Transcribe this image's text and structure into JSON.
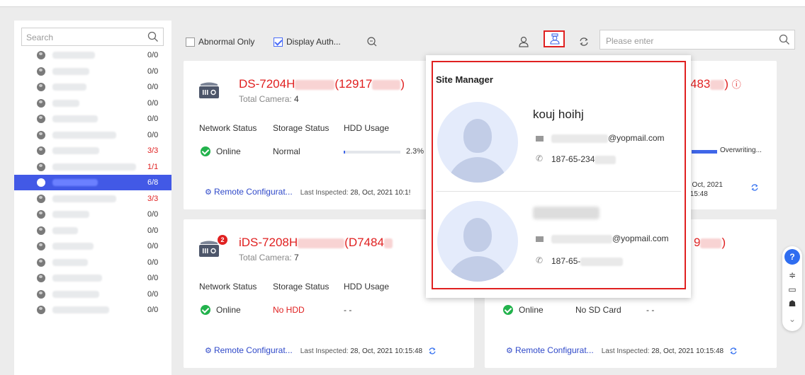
{
  "sidebar": {
    "search_placeholder": "Search",
    "rows": [
      {
        "count": "0/0",
        "warn": false,
        "selected": false
      },
      {
        "count": "0/0",
        "warn": false,
        "selected": false
      },
      {
        "count": "0/0",
        "warn": false,
        "selected": false
      },
      {
        "count": "0/0",
        "warn": false,
        "selected": false
      },
      {
        "count": "0/0",
        "warn": false,
        "selected": false
      },
      {
        "count": "0/0",
        "warn": false,
        "selected": false
      },
      {
        "count": "3/3",
        "warn": true,
        "selected": false
      },
      {
        "count": "1/1",
        "warn": true,
        "selected": false
      },
      {
        "count": "6/8",
        "warn": true,
        "selected": true
      },
      {
        "count": "3/3",
        "warn": true,
        "selected": false
      },
      {
        "count": "0/0",
        "warn": false,
        "selected": false
      },
      {
        "count": "0/0",
        "warn": false,
        "selected": false
      },
      {
        "count": "0/0",
        "warn": false,
        "selected": false
      },
      {
        "count": "0/0",
        "warn": false,
        "selected": false
      },
      {
        "count": "0/0",
        "warn": false,
        "selected": false
      },
      {
        "count": "0/0",
        "warn": false,
        "selected": false
      },
      {
        "count": "0/0",
        "warn": false,
        "selected": false
      }
    ]
  },
  "toolbar": {
    "abnormal_only": "Abnormal Only",
    "display_auth": "Display Auth...",
    "search_placeholder": "Please enter"
  },
  "cards": {
    "card1": {
      "name_prefix": "DS-7204H",
      "name_mid": "(12917",
      "name_suffix": ")",
      "total_camera_label": "Total Camera:",
      "total_camera": "4",
      "network_label": "Network Status",
      "storage_label": "Storage Status",
      "hdd_label": "HDD Usage",
      "network": "Online",
      "storage": "Normal",
      "hdd_pct": "2.3%",
      "hdd_fraction": 0.023,
      "remote": "Remote Configurat...",
      "last_inspected_label": "Last Inspected:",
      "last_inspected": "28, Oct, 2021 10:1!"
    },
    "card2": {
      "name_suffix": "483",
      "name_end": ")",
      "usage_label": "Overwriting...",
      "date_line1": ", Oct, 2021",
      "date_line2": ":15:48"
    },
    "card3": {
      "name_prefix": "iDS-7208H",
      "name_mid": "(D7484",
      "badge": "2",
      "total_camera_label": "Total Camera:",
      "total_camera": "7",
      "network_label": "Network Status",
      "storage_label": "Storage Status",
      "hdd_label": "HDD Usage",
      "network": "Online",
      "storage": "No HDD",
      "hdd_usage": "- -",
      "remote": "Remote Configurat...",
      "last_inspected_label": "Last Inspected:",
      "last_inspected": "28, Oct, 2021 10:15:48"
    },
    "card4": {
      "name_suffix": "9",
      "name_end": ")",
      "network": "Online",
      "storage": "No SD Card",
      "hdd_usage": "- -",
      "remote": "Remote Configurat...",
      "last_inspected_label": "Last Inspected:",
      "last_inspected": "28, Oct, 2021 10:15:48"
    }
  },
  "popup": {
    "title": "Site Manager",
    "manager1": {
      "name": "kouj hoihj",
      "email_suffix": "@yopmail.com",
      "phone_prefix": "187-65-234"
    },
    "manager2": {
      "email_suffix": "@yopmail.com",
      "phone_prefix": "187-65-"
    }
  },
  "float_bar": {
    "help": "?"
  },
  "colors": {
    "accent": "#4259e6",
    "alert": "#e02020",
    "ok": "#22b24c",
    "link": "#2f49c9"
  }
}
